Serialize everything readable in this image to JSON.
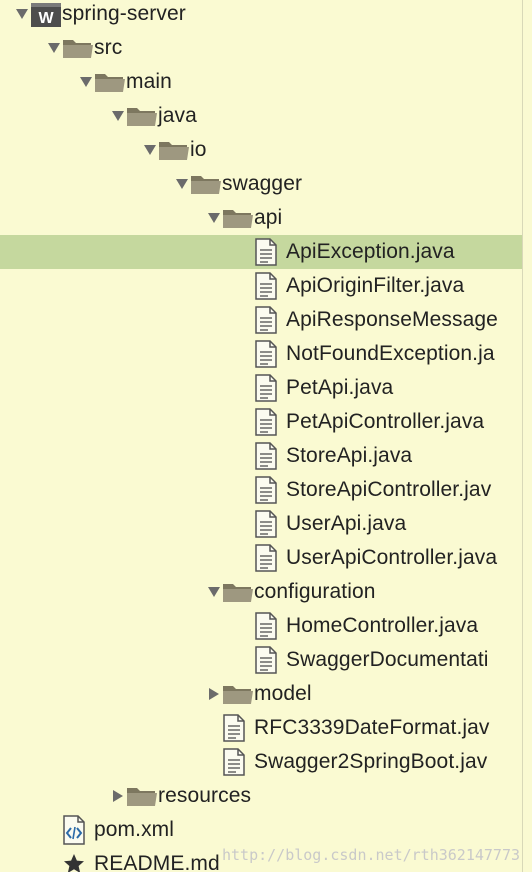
{
  "tree": [
    {
      "label": "spring-server",
      "level": 0,
      "type": "module",
      "state": "expanded",
      "icon": "module-icon"
    },
    {
      "label": "src",
      "level": 1,
      "type": "folder",
      "state": "expanded",
      "icon": "folder-icon"
    },
    {
      "label": "main",
      "level": 2,
      "type": "folder",
      "state": "expanded",
      "icon": "folder-icon"
    },
    {
      "label": "java",
      "level": 3,
      "type": "folder",
      "state": "expanded",
      "icon": "folder-icon"
    },
    {
      "label": "io",
      "level": 4,
      "type": "folder",
      "state": "expanded",
      "icon": "folder-icon"
    },
    {
      "label": "swagger",
      "level": 5,
      "type": "folder",
      "state": "expanded",
      "icon": "folder-icon"
    },
    {
      "label": "api",
      "level": 6,
      "type": "folder",
      "state": "expanded",
      "icon": "folder-icon"
    },
    {
      "label": "ApiException.java",
      "level": 7,
      "type": "file",
      "icon": "file-icon",
      "selected": true
    },
    {
      "label": "ApiOriginFilter.java",
      "level": 7,
      "type": "file",
      "icon": "file-icon"
    },
    {
      "label": "ApiResponseMessage",
      "level": 7,
      "type": "file",
      "icon": "file-icon"
    },
    {
      "label": "NotFoundException.ja",
      "level": 7,
      "type": "file",
      "icon": "file-icon"
    },
    {
      "label": "PetApi.java",
      "level": 7,
      "type": "file",
      "icon": "file-icon"
    },
    {
      "label": "PetApiController.java",
      "level": 7,
      "type": "file",
      "icon": "file-icon"
    },
    {
      "label": "StoreApi.java",
      "level": 7,
      "type": "file",
      "icon": "file-icon"
    },
    {
      "label": "StoreApiController.jav",
      "level": 7,
      "type": "file",
      "icon": "file-icon"
    },
    {
      "label": "UserApi.java",
      "level": 7,
      "type": "file",
      "icon": "file-icon"
    },
    {
      "label": "UserApiController.java",
      "level": 7,
      "type": "file",
      "icon": "file-icon"
    },
    {
      "label": "configuration",
      "level": 6,
      "type": "folder",
      "state": "expanded",
      "icon": "folder-icon"
    },
    {
      "label": "HomeController.java",
      "level": 7,
      "type": "file",
      "icon": "file-icon"
    },
    {
      "label": "SwaggerDocumentati",
      "level": 7,
      "type": "file",
      "icon": "file-icon"
    },
    {
      "label": "model",
      "level": 6,
      "type": "folder",
      "state": "collapsed",
      "icon": "folder-icon"
    },
    {
      "label": "RFC3339DateFormat.jav",
      "level": 6,
      "type": "file",
      "icon": "file-icon"
    },
    {
      "label": "Swagger2SpringBoot.jav",
      "level": 6,
      "type": "file",
      "icon": "file-icon"
    },
    {
      "label": "resources",
      "level": 3,
      "type": "folder",
      "state": "collapsed",
      "icon": "folder-icon"
    },
    {
      "label": "pom.xml",
      "level": 1,
      "type": "xml",
      "icon": "xml-file-icon"
    },
    {
      "label": "README.md",
      "level": 1,
      "type": "markdown",
      "icon": "star-icon"
    }
  ],
  "watermark": "http://blog.csdn.net/rth362147773",
  "colors": {
    "background": "#FAFAD2",
    "selection": "#C5D89E",
    "folder": "#9E9880",
    "arrow": "#6B6B6B",
    "text": "#222222"
  }
}
